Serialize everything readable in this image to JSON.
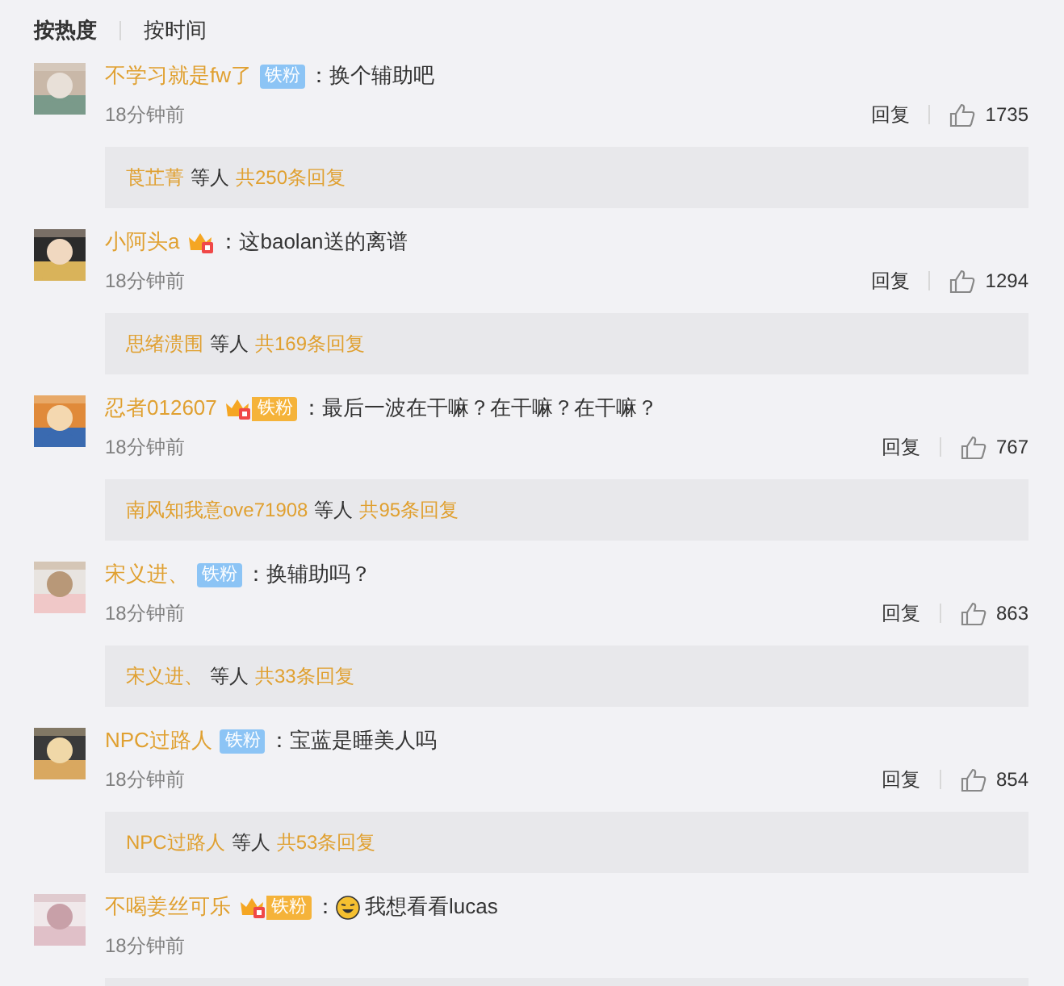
{
  "sort_tabs": [
    {
      "label": "按热度",
      "selected": true
    },
    {
      "label": "按时间",
      "selected": false
    }
  ],
  "comments": [
    {
      "user": "不学习就是fw了",
      "badge": {
        "kind": "fan",
        "label": "铁粉"
      },
      "text": "：换个辅助吧",
      "time": "18分钟前",
      "reply_action": "回复",
      "likes": "1735",
      "replies": {
        "names": "莨芷菁",
        "others": "等人",
        "count": "共250条回复"
      }
    },
    {
      "user": "小阿头a",
      "badge": {
        "kind": "crown"
      },
      "text": "：这baolan送的离谱",
      "time": "18分钟前",
      "reply_action": "回复",
      "likes": "1294",
      "replies": {
        "names": "思绪溃围",
        "others": "等人",
        "count": "共169条回复"
      }
    },
    {
      "user": "忍者012607",
      "badge": {
        "kind": "crown_fan",
        "label": "铁粉"
      },
      "text": "：最后一波在干嘛？在干嘛？在干嘛？",
      "time": "18分钟前",
      "reply_action": "回复",
      "likes": "767",
      "replies": {
        "names": "南风知我意ove71908",
        "others": "等人",
        "count": "共95条回复"
      }
    },
    {
      "user": "宋义进、",
      "badge": {
        "kind": "fan",
        "label": "铁粉"
      },
      "text": "：换辅助吗？",
      "time": "18分钟前",
      "reply_action": "回复",
      "likes": "863",
      "replies": {
        "names": "宋义进、",
        "others": "等人",
        "count": "共33条回复"
      }
    },
    {
      "user": "NPC过路人",
      "badge": {
        "kind": "fan",
        "label": "铁粉"
      },
      "text": "：宝蓝是睡美人吗",
      "time": "18分钟前",
      "reply_action": "回复",
      "likes": "854",
      "replies": {
        "names": "NPC过路人",
        "others": "等人",
        "count": "共53条回复"
      }
    },
    {
      "user": "不喝姜丝可乐",
      "badge": {
        "kind": "crown_fan",
        "label": "铁粉"
      },
      "colon": "：",
      "emoji": true,
      "text": "我想看看lucas",
      "time": "18分钟前"
    }
  ]
}
